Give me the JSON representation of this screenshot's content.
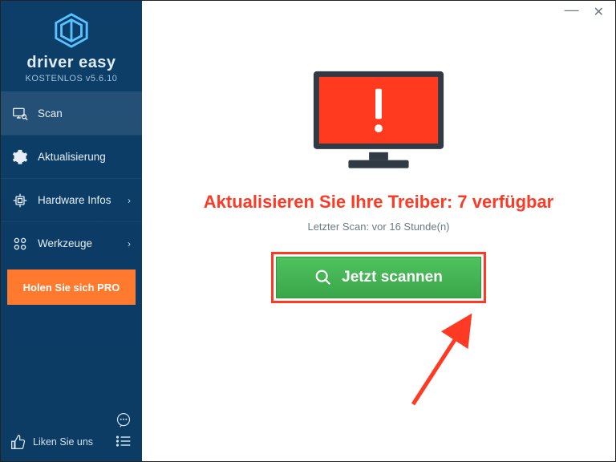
{
  "brand": {
    "name": "driver easy",
    "version": "KOSTENLOS v5.6.10"
  },
  "sidebar": {
    "items": [
      {
        "label": "Scan"
      },
      {
        "label": "Aktualisierung"
      },
      {
        "label": "Hardware Infos"
      },
      {
        "label": "Werkzeuge"
      }
    ],
    "pro_label": "Holen Sie sich PRO",
    "like_label": "Liken Sie uns"
  },
  "main": {
    "headline": "Aktualisieren Sie Ihre Treiber: 7 verfügbar",
    "last_scan": "Letzter Scan: vor 16 Stunde(n)",
    "scan_label": "Jetzt scannen"
  },
  "colors": {
    "accent": "#ff3a24",
    "sidebar": "#0c3b63",
    "pro": "#ff7a2f",
    "scan": "#3aa64a"
  }
}
